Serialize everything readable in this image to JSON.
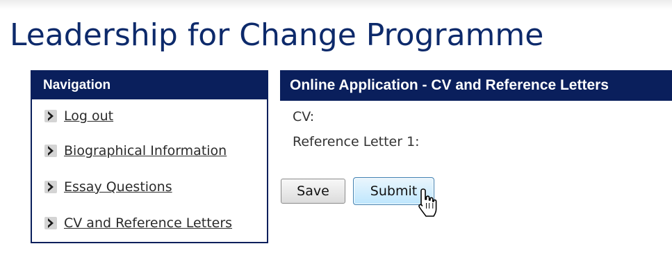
{
  "page": {
    "title": "Leadership for Change Programme"
  },
  "navigation": {
    "header": "Navigation",
    "items": [
      {
        "label": "Log out",
        "icon": "chevron-right-icon"
      },
      {
        "label": "Biographical Information",
        "icon": "chevron-right-icon"
      },
      {
        "label": "Essay Questions",
        "icon": "chevron-right-icon"
      },
      {
        "label": "CV and Reference Letters",
        "icon": "chevron-right-icon"
      }
    ]
  },
  "main": {
    "header": "Online Application - CV and Reference Letters",
    "fields": [
      {
        "label": "CV:"
      },
      {
        "label": "Reference Letter 1:"
      }
    ],
    "buttons": {
      "save_label": "Save",
      "submit_label": "Submit"
    }
  },
  "colors": {
    "brand_navy": "#0a1f5c",
    "title_blue": "#0d2a6b",
    "submit_hover_blue": "#bee6fd"
  }
}
